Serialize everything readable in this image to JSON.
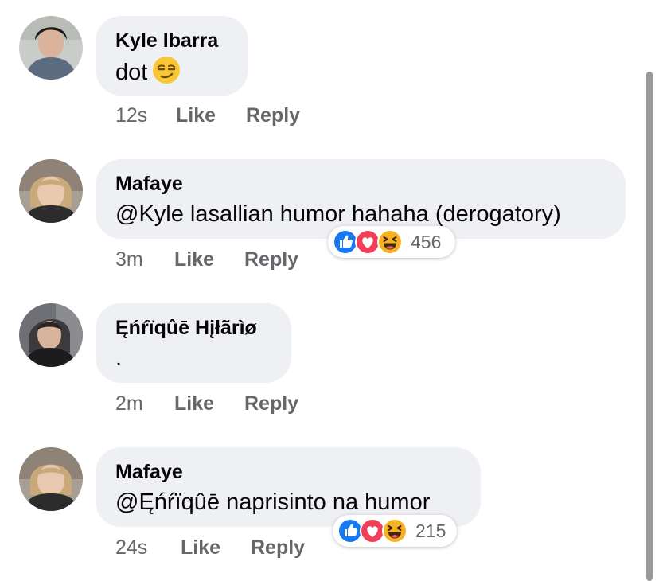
{
  "colors": {
    "bubble": "#eff0f4",
    "meta_text": "#65676b",
    "like_blue": "#1877f2",
    "love_red": "#f33e58",
    "haha_yellow": "#f7b125"
  },
  "comments": [
    {
      "author": "Kyle Ibarra",
      "text": "dot",
      "text_emoji": "smirking-face",
      "time": "12s",
      "like": "Like",
      "reply": "Reply"
    },
    {
      "author": "Mafaye",
      "text": "@Kyle lasallian humor hahaha (derogatory)",
      "time": "3m",
      "like": "Like",
      "reply": "Reply",
      "reaction_icons": [
        "like-icon",
        "love-icon",
        "haha-icon"
      ],
      "reaction_count": "456"
    },
    {
      "author": "Ęńŕïqûē Hįłãrìø",
      "text": ".",
      "time": "2m",
      "like": "Like",
      "reply": "Reply"
    },
    {
      "author": "Mafaye",
      "text": "@Ęńŕïqûē naprisinto na humor",
      "time": "24s",
      "like": "Like",
      "reply": "Reply",
      "reaction_icons": [
        "like-icon",
        "love-icon",
        "haha-icon"
      ],
      "reaction_count": "215"
    }
  ]
}
